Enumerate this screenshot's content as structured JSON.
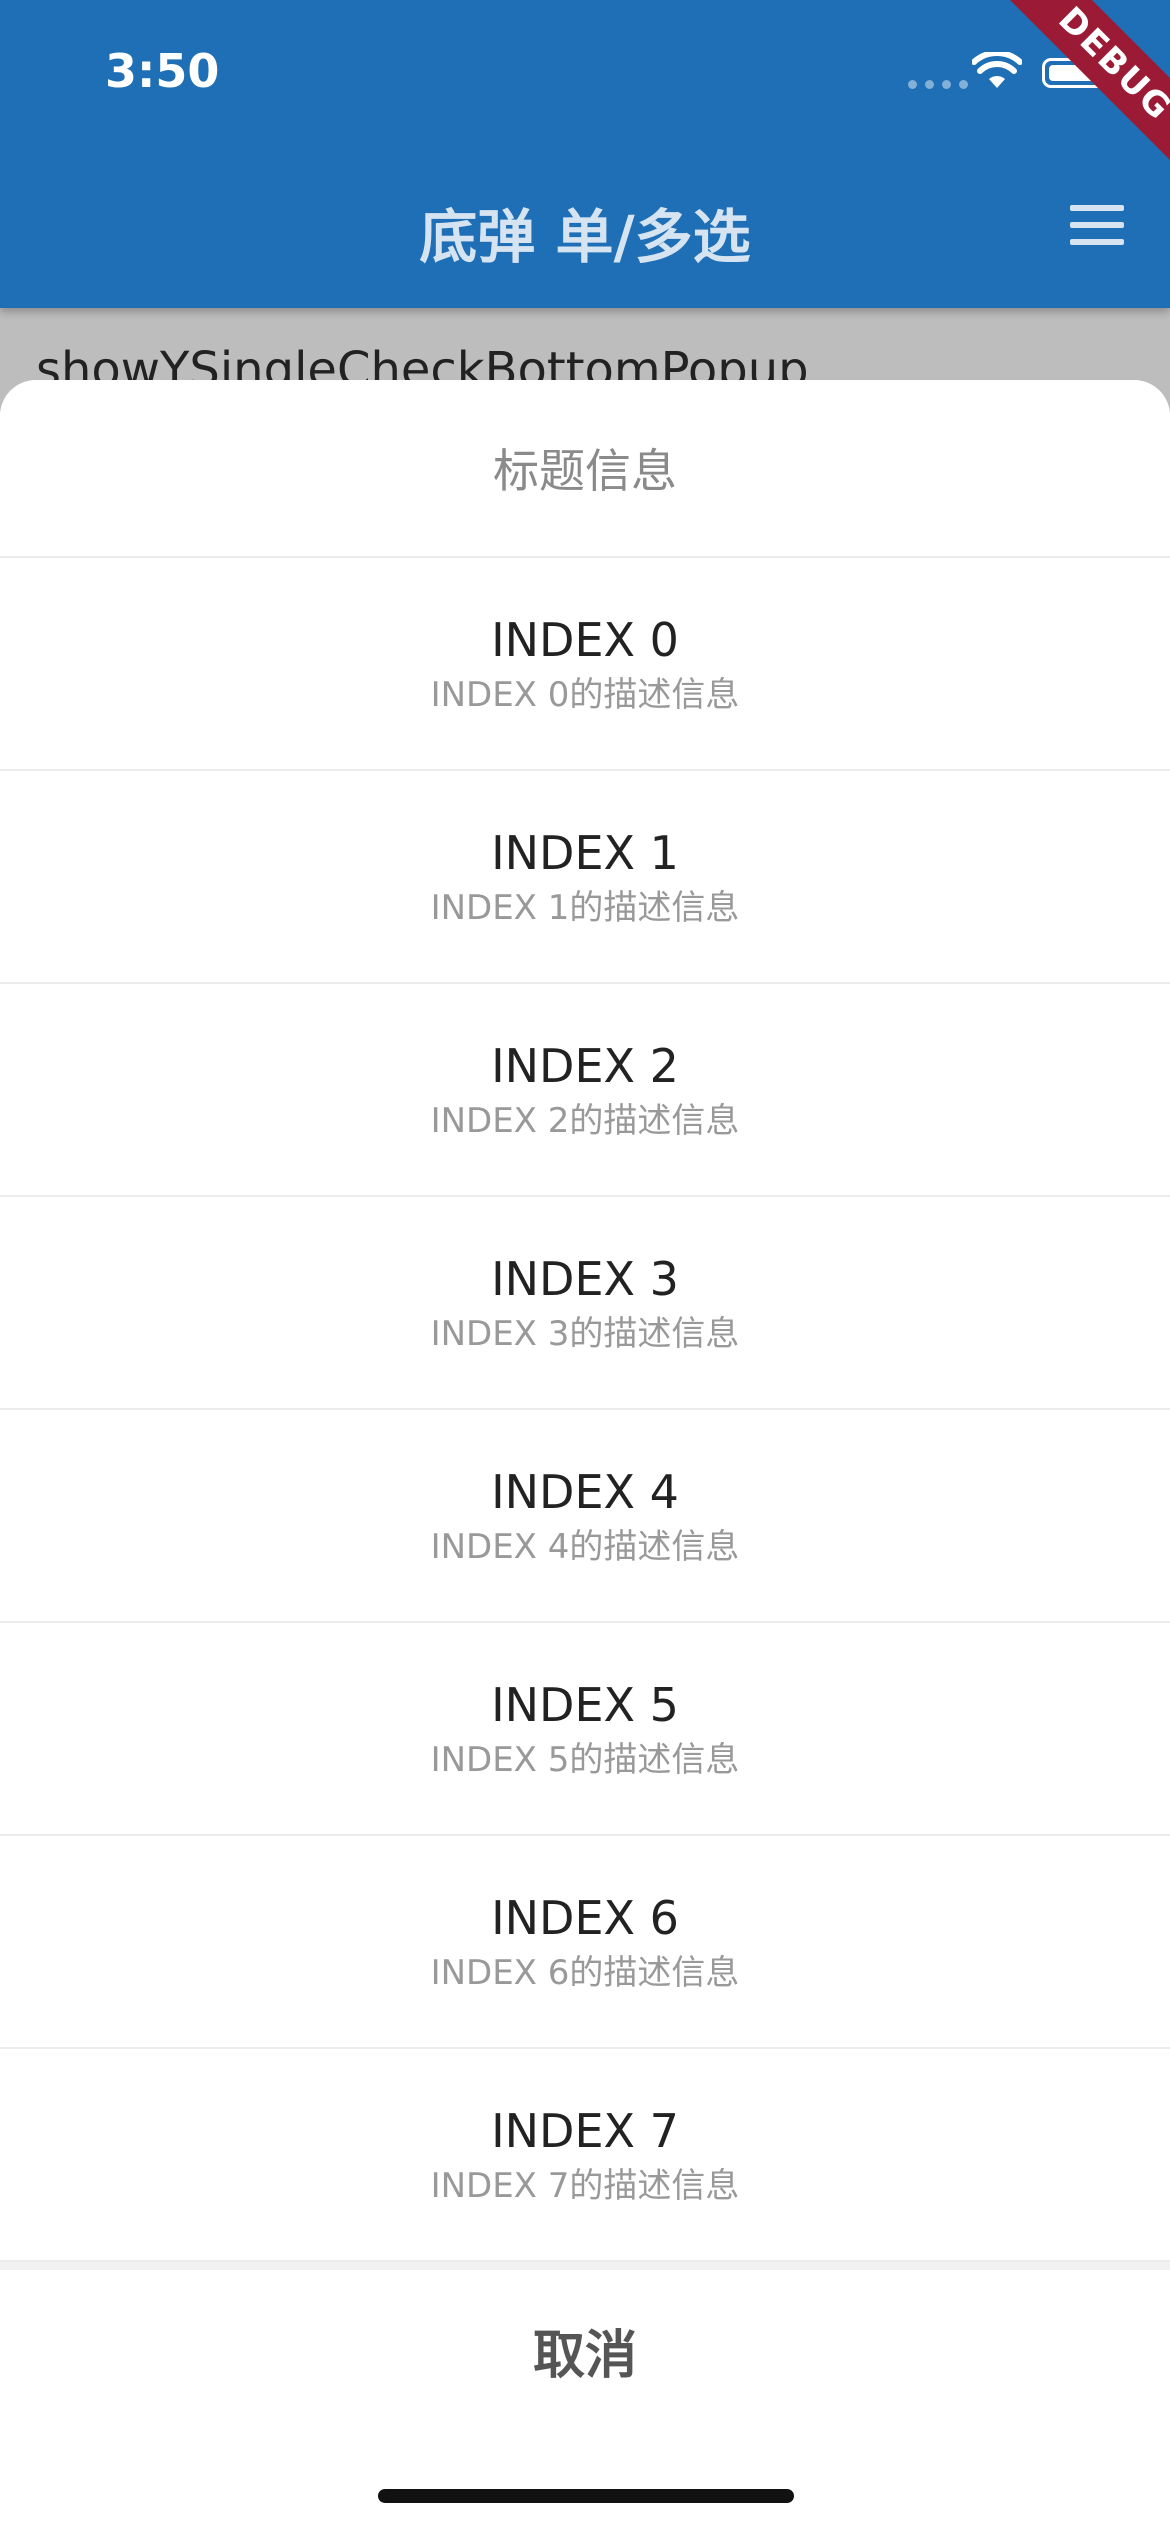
{
  "status_bar": {
    "time": "3:50",
    "debug_label": "DEBUG"
  },
  "app_bar": {
    "title": "底弹 单/多选",
    "menu_icon": "hamburger-menu-icon",
    "color": "#1e6fb6"
  },
  "background": {
    "text": "showYSingleCheckBottomPopup"
  },
  "bottom_sheet": {
    "title": "标题信息",
    "options": [
      {
        "label": "INDEX 0",
        "description": "INDEX 0的描述信息"
      },
      {
        "label": "INDEX 1",
        "description": "INDEX 1的描述信息"
      },
      {
        "label": "INDEX 2",
        "description": "INDEX 2的描述信息"
      },
      {
        "label": "INDEX 3",
        "description": "INDEX 3的描述信息"
      },
      {
        "label": "INDEX 4",
        "description": "INDEX 4的描述信息"
      },
      {
        "label": "INDEX 5",
        "description": "INDEX 5的描述信息"
      },
      {
        "label": "INDEX 6",
        "description": "INDEX 6的描述信息"
      },
      {
        "label": "INDEX 7",
        "description": "INDEX 7的描述信息"
      }
    ],
    "cancel_label": "取消"
  }
}
